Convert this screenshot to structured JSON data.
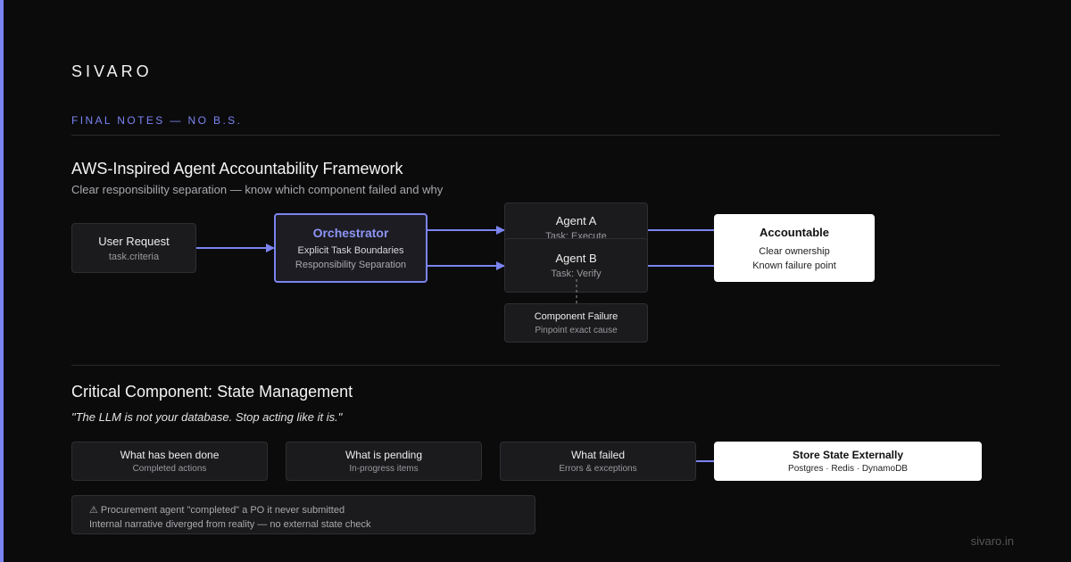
{
  "brand": "SIVARO",
  "eyebrow": "FINAL NOTES — NO B.S.",
  "section1": {
    "title": "AWS-Inspired Agent Accountability Framework",
    "subtitle": "Clear responsibility separation — know which component failed and why",
    "user_request": {
      "title": "User Request",
      "sub": "task.criteria"
    },
    "orchestrator": {
      "title": "Orchestrator",
      "line1": "Explicit Task Boundaries",
      "line2": "Responsibility Separation"
    },
    "agent_a": {
      "title": "Agent A",
      "sub": "Task: Execute"
    },
    "agent_b": {
      "title": "Agent B",
      "sub": "Task: Verify"
    },
    "failure": {
      "title": "Component Failure",
      "sub": "Pinpoint exact cause"
    },
    "accountable": {
      "title": "Accountable",
      "line1": "Clear ownership",
      "line2": "Known failure point"
    }
  },
  "section2": {
    "title": "Critical Component: State Management",
    "quote": "\"The LLM is not your database. Stop acting like it is.\"",
    "cards": [
      {
        "title": "What has been done",
        "sub": "Completed actions"
      },
      {
        "title": "What is pending",
        "sub": "In-progress items"
      },
      {
        "title": "What failed",
        "sub": "Errors & exceptions"
      }
    ],
    "store": {
      "title": "Store State Externally",
      "sub": "Postgres · Redis · DynamoDB"
    },
    "warning": {
      "line1": "⚠ Procurement agent \"completed\" a PO it never submitted",
      "line2": "Internal narrative diverged from reality — no external state check"
    }
  },
  "footer": "sivaro.in",
  "colors": {
    "accent": "#7b84f0",
    "background": "#0b0b0c",
    "box": "#1b1b1d"
  }
}
